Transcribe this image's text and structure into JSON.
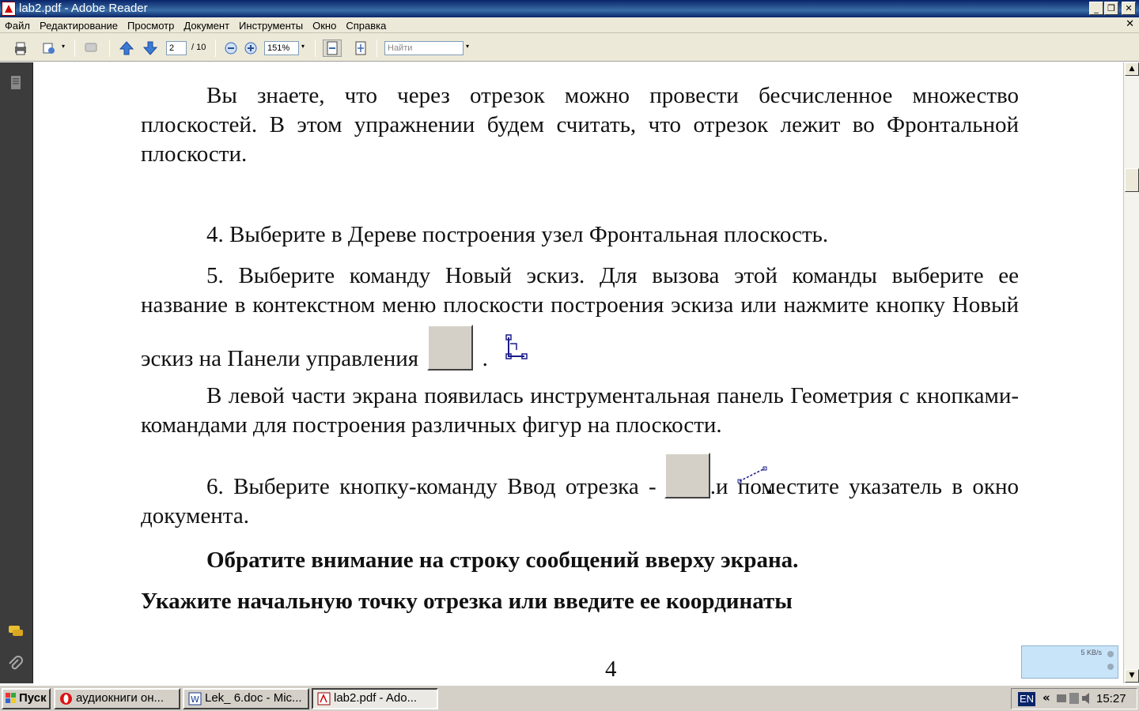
{
  "window": {
    "title": "lab2.pdf - Adobe Reader"
  },
  "menu": [
    "Файл",
    "Редактирование",
    "Просмотр",
    "Документ",
    "Инструменты",
    "Окно",
    "Справка"
  ],
  "toolbar": {
    "page_current": "2",
    "page_total": "/ 10",
    "zoom": "151%",
    "search_placeholder": "Найти"
  },
  "document": {
    "para1": "Вы знаете, что через отрезок можно провести бесчисленное множество плоскостей. В этом упражнении будем считать, что отрезок лежит во Фронтальной плоскости.",
    "para2": "4. Выберите в Дереве построения узел Фронтальная плоскость.",
    "para3_a": "5. Выберите команду Новый эскиз. Для вызова этой команды выберите ее название в контекстном меню плоскости построения эскиза или нажмите кнопку Новый эскиз на Панели управления",
    "para3_b": ".",
    "para4": "В левой части экрана появилась инструментальная панель Геометрия с кнопками-командами для построения различных фигур на плоскости.",
    "para5_a": "6. Выберите кнопку-команду Ввод отрезка -",
    "para5_b": ".и поместите указатель в окно документа.",
    "para6": "Обратите внимание на строку сообщений вверху экрана.",
    "para7": "Укажите начальную точку отрезка или введите ее координаты",
    "page_number": "4"
  },
  "netwidget": {
    "rate": "5 KB/s"
  },
  "taskbar": {
    "start": "Пуск",
    "tasks": [
      "аудиокниги он...",
      "Lek_ 6.doc - Mic...",
      "lab2.pdf - Ado..."
    ],
    "lang": "EN",
    "clock": "15:27"
  }
}
